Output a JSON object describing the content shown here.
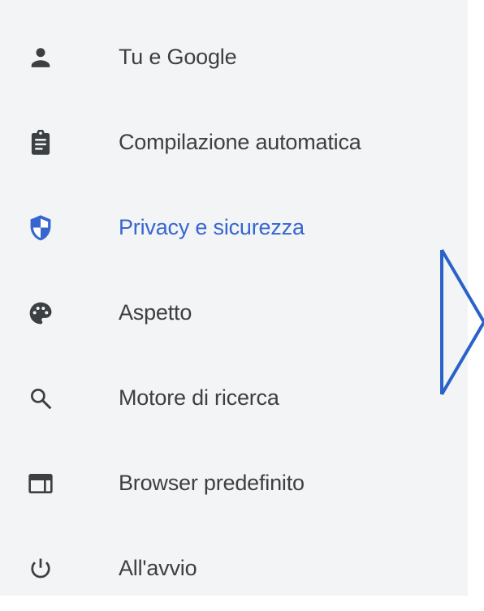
{
  "menu": {
    "items": [
      {
        "label": "Tu e Google",
        "icon": "person-icon",
        "active": false
      },
      {
        "label": "Compilazione automatica",
        "icon": "clipboard-icon",
        "active": false
      },
      {
        "label": "Privacy e sicurezza",
        "icon": "shield-icon",
        "active": true
      },
      {
        "label": "Aspetto",
        "icon": "palette-icon",
        "active": false
      },
      {
        "label": "Motore di ricerca",
        "icon": "search-icon",
        "active": false
      },
      {
        "label": "Browser predefinito",
        "icon": "browser-window-icon",
        "active": false
      },
      {
        "label": "All'avvio",
        "icon": "power-icon",
        "active": false
      }
    ]
  },
  "colors": {
    "panel_background": "#f3f4f6",
    "text": "#3c4043",
    "icon": "#3c4043",
    "active": "#3666cf",
    "arrow_outline": "#2a62c9"
  },
  "overlay": {
    "icon": "play-triangle-outline-icon"
  }
}
